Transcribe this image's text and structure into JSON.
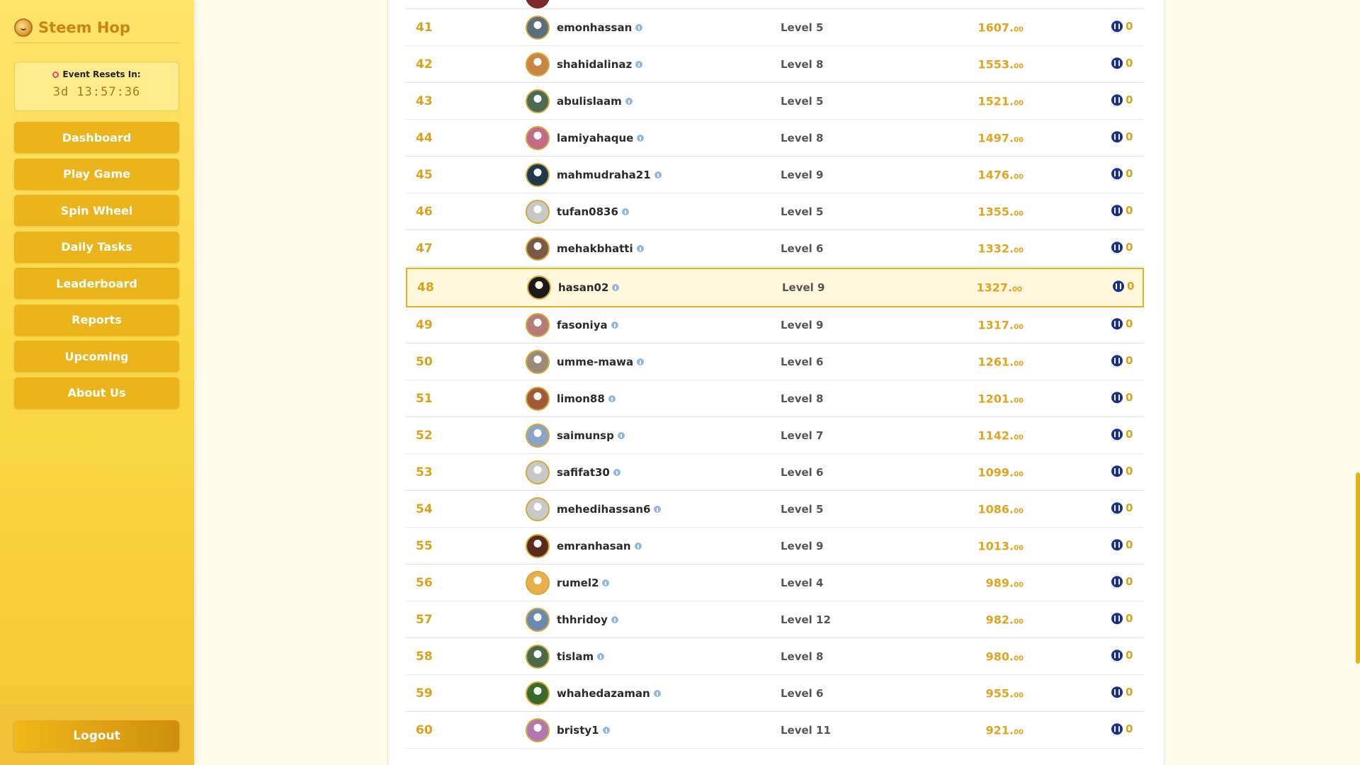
{
  "brand": {
    "name": "Steem Hop"
  },
  "timer": {
    "label": "Event Resets In:",
    "value": "3d 13:57:36"
  },
  "nav": [
    "Dashboard",
    "Play Game",
    "Spin Wheel",
    "Daily Tasks",
    "Leaderboard",
    "Reports",
    "Upcoming",
    "About Us"
  ],
  "logout": "Logout",
  "leaderboard": {
    "current_user": "hasan02",
    "rows": [
      {
        "rank": "41",
        "user": "emonhassan",
        "level": "Level 5",
        "score": "1607.",
        "dec": "00",
        "reward": "0",
        "avatar": "#5b6e7f"
      },
      {
        "rank": "42",
        "user": "shahidalinaz",
        "level": "Level 8",
        "score": "1553.",
        "dec": "00",
        "reward": "0",
        "avatar": "#c98544"
      },
      {
        "rank": "43",
        "user": "abulislaam",
        "level": "Level 5",
        "score": "1521.",
        "dec": "00",
        "reward": "0",
        "avatar": "#4d6a55"
      },
      {
        "rank": "44",
        "user": "lamiyahaque",
        "level": "Level 8",
        "score": "1497.",
        "dec": "00",
        "reward": "0",
        "avatar": "#c26a8a"
      },
      {
        "rank": "45",
        "user": "mahmudraha21",
        "level": "Level 9",
        "score": "1476.",
        "dec": "00",
        "reward": "0",
        "avatar": "#1e3a4a"
      },
      {
        "rank": "46",
        "user": "tufan0836",
        "level": "Level 5",
        "score": "1355.",
        "dec": "00",
        "reward": "0",
        "avatar": "#c8c8c8"
      },
      {
        "rank": "47",
        "user": "mehakbhatti",
        "level": "Level 6",
        "score": "1332.",
        "dec": "00",
        "reward": "0",
        "avatar": "#7b5a45"
      },
      {
        "rank": "48",
        "user": "hasan02",
        "level": "Level 9",
        "score": "1327.",
        "dec": "00",
        "reward": "0",
        "avatar": "#1a1a1a"
      },
      {
        "rank": "49",
        "user": "fasoniya",
        "level": "Level 9",
        "score": "1317.",
        "dec": "00",
        "reward": "0",
        "avatar": "#b57a7a"
      },
      {
        "rank": "50",
        "user": "umme-mawa",
        "level": "Level 6",
        "score": "1261.",
        "dec": "00",
        "reward": "0",
        "avatar": "#9a8a7a"
      },
      {
        "rank": "51",
        "user": "limon88",
        "level": "Level 8",
        "score": "1201.",
        "dec": "00",
        "reward": "0",
        "avatar": "#a05a3a"
      },
      {
        "rank": "52",
        "user": "saimunsp",
        "level": "Level 7",
        "score": "1142.",
        "dec": "00",
        "reward": "0",
        "avatar": "#8aa4c8"
      },
      {
        "rank": "53",
        "user": "safifat30",
        "level": "Level 6",
        "score": "1099.",
        "dec": "00",
        "reward": "0",
        "avatar": "#c8c8c8"
      },
      {
        "rank": "54",
        "user": "mehedihassan6",
        "level": "Level 5",
        "score": "1086.",
        "dec": "00",
        "reward": "0",
        "avatar": "#c8c8c8"
      },
      {
        "rank": "55",
        "user": "emranhasan",
        "level": "Level 9",
        "score": "1013.",
        "dec": "00",
        "reward": "0",
        "avatar": "#5a2a1a"
      },
      {
        "rank": "56",
        "user": "rumel2",
        "level": "Level 4",
        "score": "989.",
        "dec": "00",
        "reward": "0",
        "avatar": "#e8b04a"
      },
      {
        "rank": "57",
        "user": "thhridoy",
        "level": "Level 12",
        "score": "982.",
        "dec": "00",
        "reward": "0",
        "avatar": "#6a8ab0"
      },
      {
        "rank": "58",
        "user": "tislam",
        "level": "Level 8",
        "score": "980.",
        "dec": "00",
        "reward": "0",
        "avatar": "#4a6a4a"
      },
      {
        "rank": "59",
        "user": "whahedazaman",
        "level": "Level 6",
        "score": "955.",
        "dec": "00",
        "reward": "0",
        "avatar": "#3a6a2a"
      },
      {
        "rank": "60",
        "user": "bristy1",
        "level": "Level 11",
        "score": "921.",
        "dec": "00",
        "reward": "0",
        "avatar": "#b07ab0"
      }
    ]
  }
}
